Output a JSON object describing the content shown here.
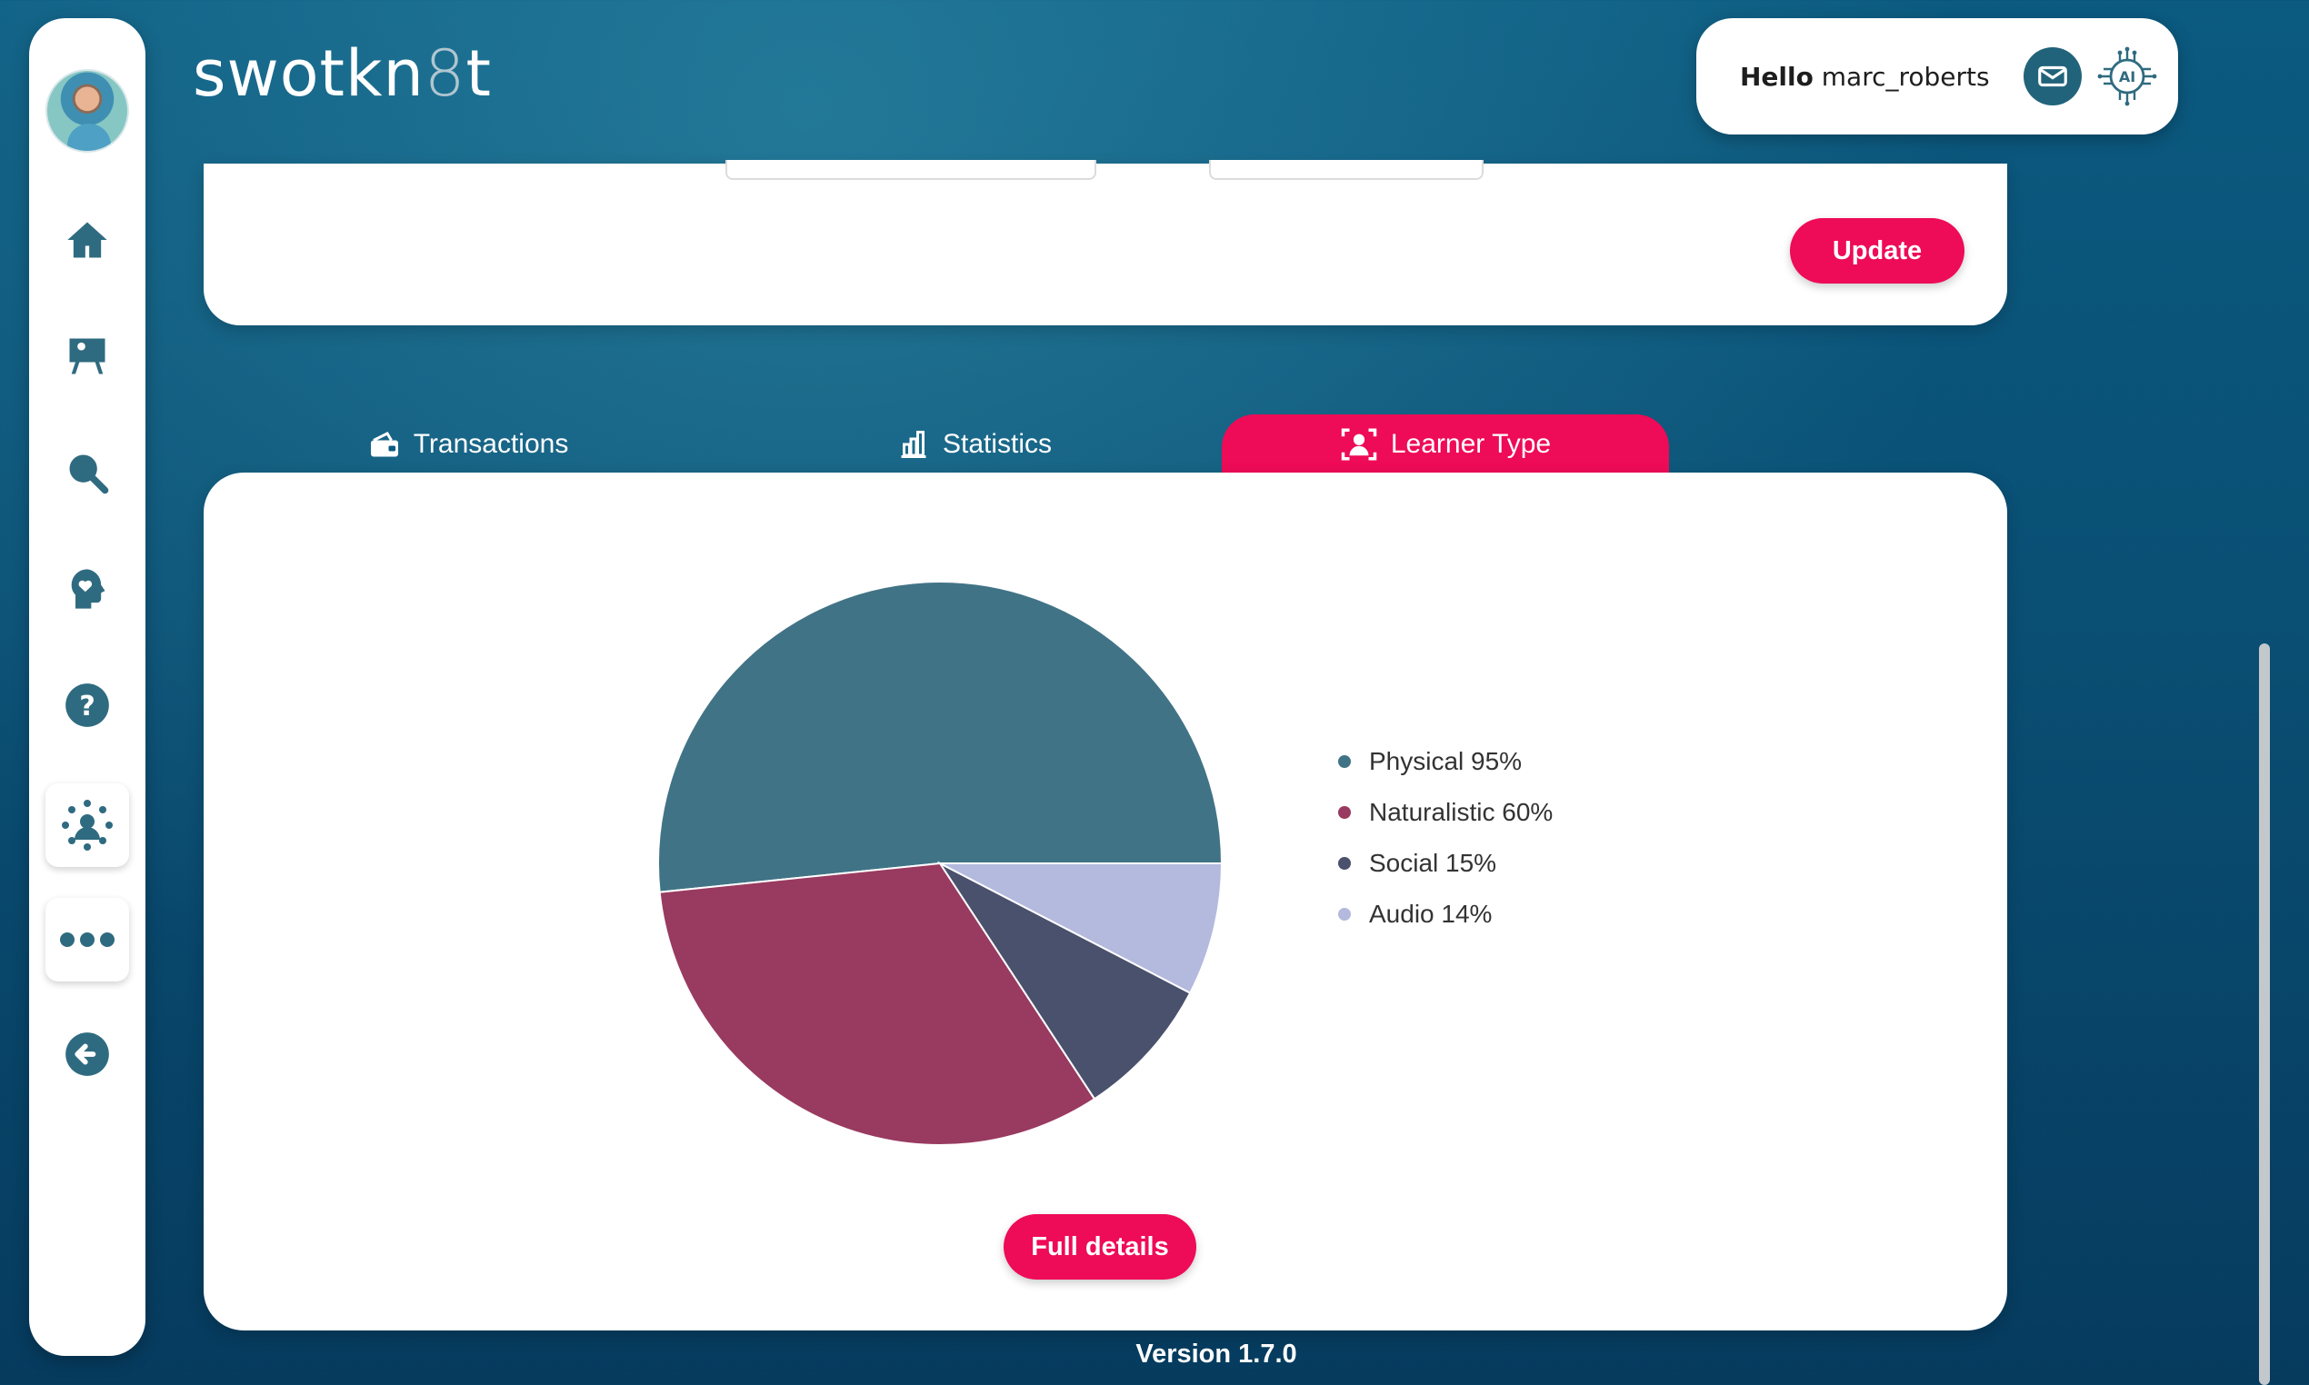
{
  "app": {
    "logo_prefix": "swotkn",
    "logo_eight": "8",
    "logo_suffix": "t"
  },
  "header": {
    "greeting": "Hello",
    "username": "marc_roberts",
    "mail_icon": "mail-icon",
    "ai_icon": "ai-chip-icon"
  },
  "sidebar": {
    "items": [
      {
        "icon": "home-icon"
      },
      {
        "icon": "classroom-board-icon"
      },
      {
        "icon": "search-icon"
      },
      {
        "icon": "head-heart-icon"
      },
      {
        "icon": "help-icon"
      },
      {
        "icon": "community-icon"
      },
      {
        "icon": "more-icon"
      },
      {
        "icon": "logout-icon"
      }
    ]
  },
  "top_card": {
    "update_label": "Update"
  },
  "tabs": [
    {
      "label": "Transactions",
      "icon": "wallet-icon",
      "active": false
    },
    {
      "label": "Statistics",
      "icon": "bar-chart-icon",
      "active": false
    },
    {
      "label": "Learner Type",
      "icon": "learner-focus-icon",
      "active": true
    }
  ],
  "chart_data": {
    "type": "pie",
    "categories": [
      "Physical",
      "Naturalistic",
      "Social",
      "Audio"
    ],
    "values": [
      95,
      60,
      15,
      14
    ],
    "legend_labels": [
      "Physical 95%",
      "Naturalistic 60%",
      "Social 15%",
      "Audio 14%"
    ],
    "colors": [
      "#417386",
      "#993a60",
      "#4a516d",
      "#b4b9de"
    ],
    "legend_position": "right"
  },
  "main_card": {
    "full_details_label": "Full details"
  },
  "footer": {
    "version": "Version 1.7.0"
  },
  "colors": {
    "accent": "#ee0b57",
    "primary": "#21637a"
  }
}
